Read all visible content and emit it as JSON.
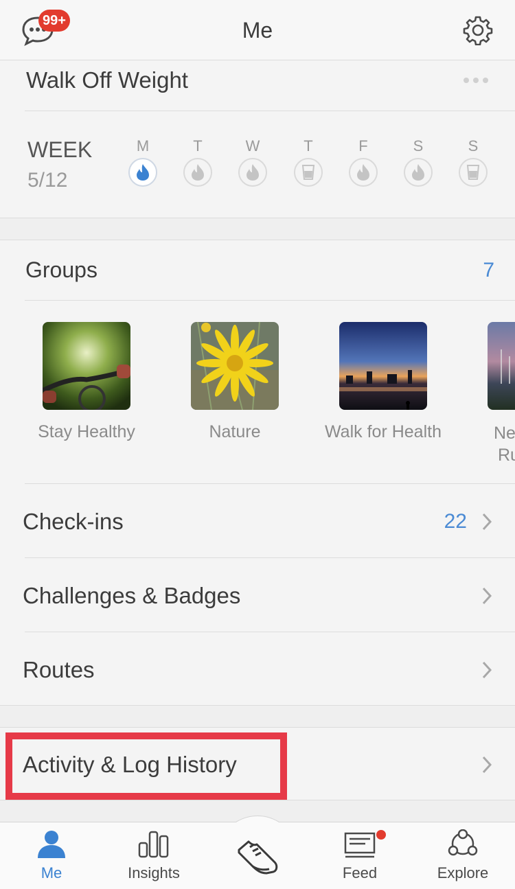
{
  "header": {
    "title": "Me",
    "badge": "99+"
  },
  "challenge": {
    "title": "Walk Off Weight",
    "week_label": "WEEK",
    "week_count": "5/12",
    "days": [
      {
        "letter": "M",
        "icon": "flame-icon",
        "active": true
      },
      {
        "letter": "T",
        "icon": "flame-icon",
        "active": false
      },
      {
        "letter": "W",
        "icon": "flame-icon",
        "active": false
      },
      {
        "letter": "T",
        "icon": "cup-icon",
        "active": false
      },
      {
        "letter": "F",
        "icon": "flame-icon",
        "active": false
      },
      {
        "letter": "S",
        "icon": "flame-icon",
        "active": false
      },
      {
        "letter": "S",
        "icon": "cup-icon",
        "active": false
      }
    ]
  },
  "groups": {
    "label": "Groups",
    "count": "7",
    "items": [
      {
        "name": "Stay Healthy"
      },
      {
        "name": "Nature"
      },
      {
        "name": "Walk for Health"
      },
      {
        "name": "Ne",
        "name_line2": "Ru"
      }
    ]
  },
  "rows": {
    "checkins": {
      "label": "Check-ins",
      "count": "22"
    },
    "challenges": {
      "label": "Challenges & Badges"
    },
    "routes": {
      "label": "Routes"
    },
    "activity": {
      "label": "Activity & Log History"
    }
  },
  "tabs": [
    {
      "label": "Me",
      "icon": "person-icon",
      "active": true
    },
    {
      "label": "Insights",
      "icon": "bar-chart-icon",
      "active": false
    },
    {
      "label": "",
      "icon": "shoe-icon",
      "active": false
    },
    {
      "label": "Feed",
      "icon": "feed-icon",
      "active": false
    },
    {
      "label": "Explore",
      "icon": "explore-icon",
      "active": false
    }
  ],
  "colors": {
    "accent": "#3b82d1",
    "badge": "#e23b2e",
    "highlight": "#e63a48"
  }
}
